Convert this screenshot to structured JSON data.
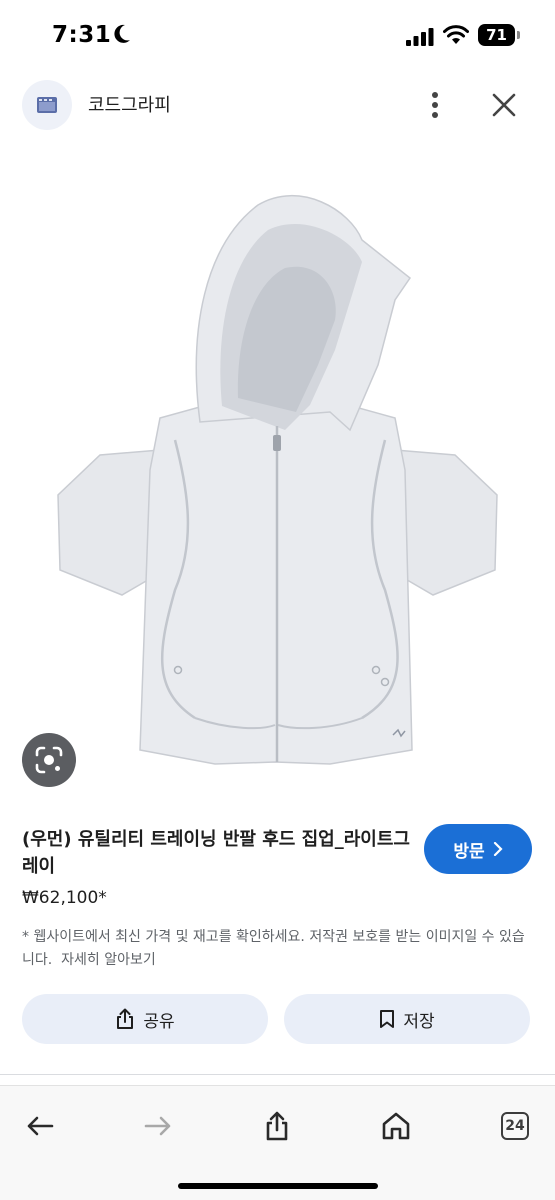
{
  "status_bar": {
    "time": "7:31",
    "battery_level": "71",
    "icons": [
      "moon-icon",
      "cellular-signal-icon",
      "wifi-icon",
      "battery-icon"
    ]
  },
  "header": {
    "site_name": "코드그라피",
    "icons": [
      "site-favicon",
      "more-vert-icon",
      "close-icon"
    ]
  },
  "product": {
    "title": "(우먼) 유틸리티 트레이닝 반팔 후드 집업_라이트그레이",
    "price": "₩62,100*",
    "visit_label": "방문",
    "disclaimer": "* 웹사이트에서 최신 가격 및 재고를 확인하세요. 저작권 보호를 받는 이미지일 수 있습니다.",
    "learn_more": "자세히 알아보기",
    "image_icon": "lens-search-icon"
  },
  "actions": {
    "share_label": "공유",
    "save_label": "저장"
  },
  "toolbar": {
    "tab_count": "24",
    "icons": [
      "back-arrow-icon",
      "forward-arrow-icon",
      "share-icon",
      "home-icon",
      "tabs-icon"
    ]
  },
  "colors": {
    "accent": "#1b6fd6",
    "action_button_bg": "#e9eef8",
    "garment": "#e6e8ec"
  }
}
